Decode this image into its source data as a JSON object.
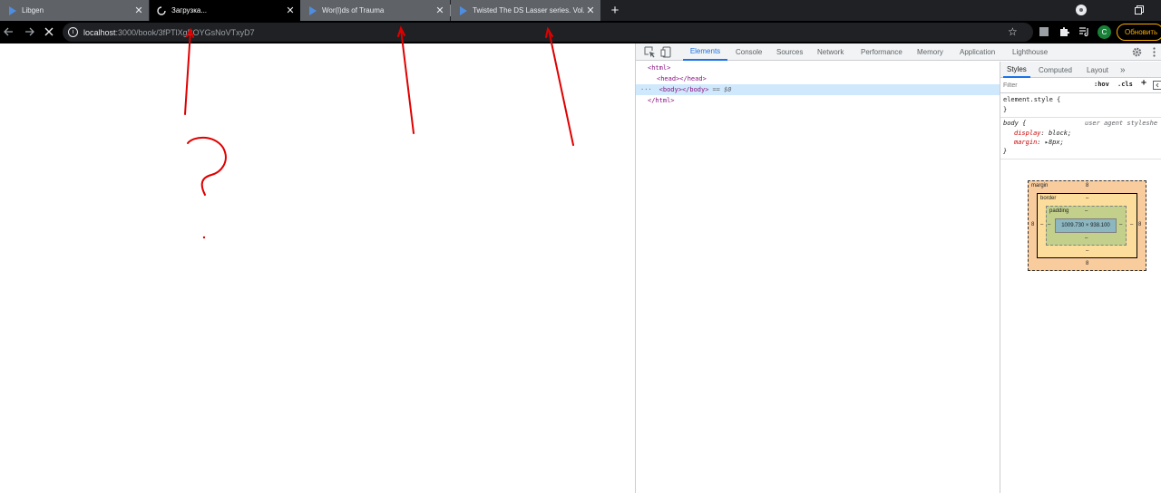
{
  "tabs": [
    {
      "title": "Libgen",
      "state": "inactive",
      "favicon": "play-triangle-icon"
    },
    {
      "title": "Загрузка...",
      "state": "active",
      "favicon": "loading-spinner-icon"
    },
    {
      "title": "Wor(l)ds of Trauma",
      "state": "inactive",
      "favicon": "play-triangle-icon"
    },
    {
      "title": "Twisted The DS Lasser series. Vol.",
      "state": "inactive",
      "favicon": "play-triangle-icon"
    }
  ],
  "toolbar": {
    "url_host": "localhost",
    "url_path": ":3000/book/3fPTlXgBOYGsNoVTxyD7",
    "update_label": "Обновить",
    "avatar_letter": "C"
  },
  "devtools": {
    "tabs": [
      "Elements",
      "Console",
      "Sources",
      "Network",
      "Performance",
      "Memory",
      "Application",
      "Lighthouse"
    ],
    "active_tab": "Elements",
    "dom": {
      "html_open": "<html>",
      "head": "<head></head>",
      "body": "<body></body>",
      "body_suffix": "== $0",
      "html_close": "</html>",
      "ellipsis": "···"
    },
    "styles_tabs": [
      "Styles",
      "Computed",
      "Layout"
    ],
    "more_tabs": "»",
    "filter_placeholder": "Filter",
    "hov_label": ":hov",
    "cls_label": ".cls",
    "plus_label": "+",
    "element_style_selector": "element.style {",
    "element_style_close": "}",
    "body_rule": {
      "selector": "body {",
      "source": "user agent styleshe",
      "props": [
        {
          "name": "display",
          "value": "block;"
        },
        {
          "name": "margin",
          "value": "8px;"
        }
      ],
      "close": "}"
    },
    "box_model": {
      "margin_label": "margin",
      "margin_top": "8",
      "margin_bottom": "8",
      "margin_left": "8",
      "margin_right": "8",
      "border_label": "border",
      "border_top": "–",
      "border_bottom": "–",
      "border_left": "–",
      "border_right": "–",
      "padding_label": "padding",
      "padding_top": "–",
      "padding_bottom": "–",
      "padding_left": "–",
      "padding_right": "–",
      "content_size": "1009.730 × 938.100"
    }
  },
  "colors": {
    "tab_strip": "#202124",
    "inactive_tab": "#5f6368",
    "annotation_red": "#e00000",
    "devtools_accent": "#1a73e8"
  }
}
